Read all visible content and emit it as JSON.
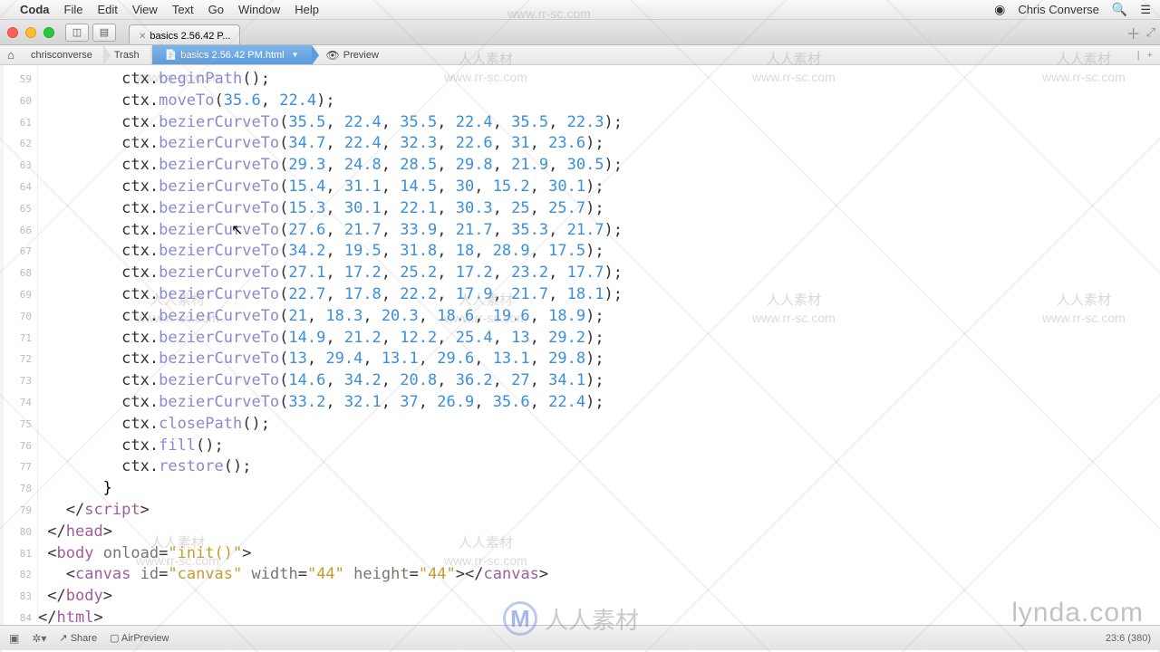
{
  "menubar": {
    "app": "Coda",
    "items": [
      "File",
      "Edit",
      "View",
      "Text",
      "Go",
      "Window",
      "Help"
    ],
    "user": "Chris Converse"
  },
  "titlebar": {
    "tab_label": "basics 2.56.42 P..."
  },
  "breadcrumb": {
    "seg1": "chrisconverse",
    "seg2": "Trash",
    "active": "basics 2.56.42 PM.html",
    "preview": "Preview"
  },
  "gutter_start": 59,
  "code_lines": [
    {
      "type": "call",
      "indent": "         ",
      "obj": "ctx",
      "method": "beginPath",
      "args": []
    },
    {
      "type": "call",
      "indent": "         ",
      "obj": "ctx",
      "method": "moveTo",
      "args": [
        35.6,
        22.4
      ]
    },
    {
      "type": "call",
      "indent": "         ",
      "obj": "ctx",
      "method": "bezierCurveTo",
      "args": [
        35.5,
        22.4,
        35.5,
        22.4,
        35.5,
        22.3
      ]
    },
    {
      "type": "call",
      "indent": "         ",
      "obj": "ctx",
      "method": "bezierCurveTo",
      "args": [
        34.7,
        22.4,
        32.3,
        22.6,
        31.0,
        23.6
      ]
    },
    {
      "type": "call",
      "indent": "         ",
      "obj": "ctx",
      "method": "bezierCurveTo",
      "args": [
        29.3,
        24.8,
        28.5,
        29.8,
        21.9,
        30.5
      ]
    },
    {
      "type": "call",
      "indent": "         ",
      "obj": "ctx",
      "method": "bezierCurveTo",
      "args": [
        15.4,
        31.1,
        14.5,
        30.0,
        15.2,
        30.1
      ]
    },
    {
      "type": "call",
      "indent": "         ",
      "obj": "ctx",
      "method": "bezierCurveTo",
      "args": [
        15.3,
        30.1,
        22.1,
        30.3,
        25.0,
        25.7
      ]
    },
    {
      "type": "call",
      "indent": "         ",
      "obj": "ctx",
      "method": "bezierCurveTo",
      "args": [
        27.6,
        21.7,
        33.9,
        21.7,
        35.3,
        21.7
      ]
    },
    {
      "type": "call",
      "indent": "         ",
      "obj": "ctx",
      "method": "bezierCurveTo",
      "args": [
        34.2,
        19.5,
        31.8,
        18.0,
        28.9,
        17.5
      ]
    },
    {
      "type": "call",
      "indent": "         ",
      "obj": "ctx",
      "method": "bezierCurveTo",
      "args": [
        27.1,
        17.2,
        25.2,
        17.2,
        23.2,
        17.7
      ]
    },
    {
      "type": "call",
      "indent": "         ",
      "obj": "ctx",
      "method": "bezierCurveTo",
      "args": [
        22.7,
        17.8,
        22.2,
        17.9,
        21.7,
        18.1
      ]
    },
    {
      "type": "call",
      "indent": "         ",
      "obj": "ctx",
      "method": "bezierCurveTo",
      "args": [
        21.0,
        18.3,
        20.3,
        18.6,
        19.6,
        18.9
      ]
    },
    {
      "type": "call",
      "indent": "         ",
      "obj": "ctx",
      "method": "bezierCurveTo",
      "args": [
        14.9,
        21.2,
        12.2,
        25.4,
        13.0,
        29.2
      ]
    },
    {
      "type": "call",
      "indent": "         ",
      "obj": "ctx",
      "method": "bezierCurveTo",
      "args": [
        13.0,
        29.4,
        13.1,
        29.6,
        13.1,
        29.8
      ]
    },
    {
      "type": "call",
      "indent": "         ",
      "obj": "ctx",
      "method": "bezierCurveTo",
      "args": [
        14.6,
        34.2,
        20.8,
        36.2,
        27.0,
        34.1
      ]
    },
    {
      "type": "call",
      "indent": "         ",
      "obj": "ctx",
      "method": "bezierCurveTo",
      "args": [
        33.2,
        32.1,
        37.0,
        26.9,
        35.6,
        22.4
      ]
    },
    {
      "type": "call",
      "indent": "         ",
      "obj": "ctx",
      "method": "closePath",
      "args": []
    },
    {
      "type": "call",
      "indent": "         ",
      "obj": "ctx",
      "method": "fill",
      "args": []
    },
    {
      "type": "call",
      "indent": "         ",
      "obj": "ctx",
      "method": "restore",
      "args": []
    },
    {
      "type": "raw",
      "text": "       }"
    },
    {
      "type": "closetag",
      "indent": "   ",
      "tag": "script"
    },
    {
      "type": "closetag",
      "indent": " ",
      "tag": "head"
    },
    {
      "type": "opentag",
      "indent": " ",
      "tag": "body",
      "attrs": [
        {
          "name": "onload",
          "val": "init()"
        }
      ]
    },
    {
      "type": "canvas",
      "indent": "   ",
      "attrs": [
        {
          "name": "id",
          "val": "canvas"
        },
        {
          "name": "width",
          "val": "44"
        },
        {
          "name": "height",
          "val": "44"
        }
      ]
    },
    {
      "type": "closetag",
      "indent": " ",
      "tag": "body"
    },
    {
      "type": "closetag",
      "indent": "",
      "tag": "html"
    }
  ],
  "statusbar": {
    "share": "Share",
    "airpreview": "AirPreview",
    "position": "23:6 (380)"
  },
  "watermarks": {
    "cn": "人人素材",
    "url": "www.rr-sc.com",
    "lynda": "lynda.com"
  }
}
